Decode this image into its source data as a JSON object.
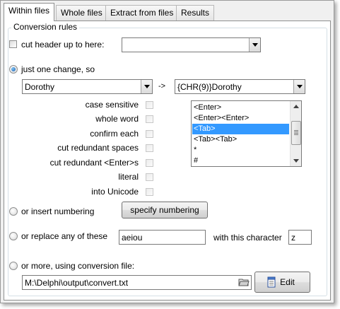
{
  "tabs": [
    {
      "label": "Within files",
      "active": true
    },
    {
      "label": "Whole files",
      "active": false
    },
    {
      "label": "Extract from files",
      "active": false
    },
    {
      "label": "Results",
      "active": false
    }
  ],
  "group": {
    "title": "Conversion rules"
  },
  "cut_header": {
    "label": "cut header up to here:",
    "checked": false,
    "value": ""
  },
  "one_change": {
    "label": "just one change, so",
    "selected": true,
    "from_value": "Dorothy",
    "arrow": "->",
    "to_value": "{CHR(9)}Dorothy"
  },
  "options": [
    {
      "label": "case sensitive",
      "checked": false
    },
    {
      "label": "whole word",
      "checked": false
    },
    {
      "label": "confirm each",
      "checked": false
    },
    {
      "label": "cut redundant spaces",
      "checked": false
    },
    {
      "label": "cut redundant <Enter>s",
      "checked": false
    },
    {
      "label": "literal",
      "checked": false
    },
    {
      "label": "into Unicode",
      "checked": false
    }
  ],
  "special_list": {
    "items": [
      "<Enter>",
      "<Enter><Enter>",
      "<Tab>",
      "<Tab><Tab>",
      "*",
      "#"
    ],
    "selected_index": 2
  },
  "numbering": {
    "label": "or insert numbering",
    "selected": false,
    "button_label": "specify numbering"
  },
  "replace_any": {
    "label": "or replace any of these",
    "selected": false,
    "chars_value": "aeiou",
    "with_label": "with this character",
    "char_value": "z"
  },
  "conversion_file": {
    "label": "or more, using conversion file:",
    "selected": false,
    "path": "M:\\Delphi\\output\\convert.txt",
    "edit_label": "Edit"
  },
  "icons": {
    "browse": "folder-open-icon",
    "edit": "notepad-icon"
  },
  "colors": {
    "selection": "#3399ff",
    "radio_dot": "#1a5fb4"
  }
}
